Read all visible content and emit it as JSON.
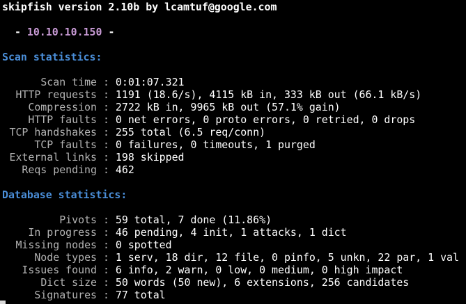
{
  "header": {
    "banner": "skipfish version 2.10b by lcamtuf@google.com",
    "target_dash_left": "-",
    "target": "10.10.10.150",
    "target_dash_right": "-"
  },
  "scan_stats": {
    "title": "Scan statistics:",
    "rows": [
      {
        "label": "Scan time",
        "value": "0:01:07.321"
      },
      {
        "label": "HTTP requests",
        "value": "1191 (18.6/s), 4115 kB in, 333 kB out (66.1 kB/s)"
      },
      {
        "label": "Compression",
        "value": "2722 kB in, 9965 kB out (57.1% gain)"
      },
      {
        "label": "HTTP faults",
        "value": "0 net errors, 0 proto errors, 0 retried, 0 drops"
      },
      {
        "label": "TCP handshakes",
        "value": "255 total (6.5 req/conn)"
      },
      {
        "label": "TCP faults",
        "value": "0 failures, 0 timeouts, 1 purged"
      },
      {
        "label": "External links",
        "value": "198 skipped"
      },
      {
        "label": "Reqs pending",
        "value": "462"
      }
    ]
  },
  "db_stats": {
    "title": "Database statistics:",
    "rows": [
      {
        "label": "Pivots",
        "value": "59 total, 7 done (11.86%)"
      },
      {
        "label": "In progress",
        "value": "46 pending, 4 init, 1 attacks, 1 dict"
      },
      {
        "label": "Missing nodes",
        "value": "0 spotted"
      },
      {
        "label": "Node types",
        "value": "1 serv, 18 dir, 12 file, 0 pinfo, 5 unkn, 22 par, 1 val"
      },
      {
        "label": "Issues found",
        "value": "6 info, 2 warn, 0 low, 0 medium, 0 high impact"
      },
      {
        "label": "Dict size",
        "value": "50 words (50 new), 6 extensions, 256 candidates"
      },
      {
        "label": "Signatures",
        "value": "77 total"
      }
    ]
  },
  "separator": ":",
  "colors": {
    "background": "#000000",
    "section_title": "#4a8ed8",
    "target": "#c99bd6",
    "label": "#b3b3b3",
    "value": "#ffffff"
  }
}
